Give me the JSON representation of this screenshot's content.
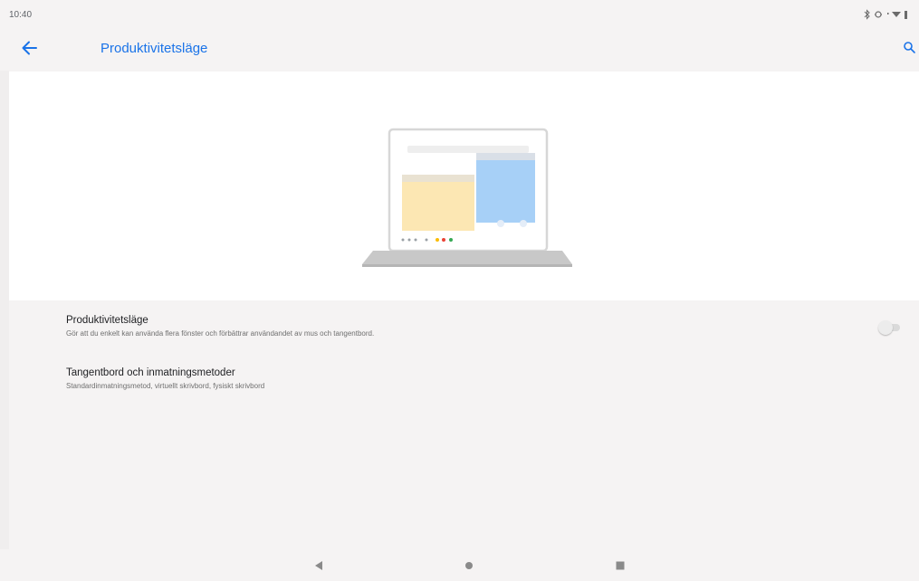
{
  "status_bar": {
    "time": "10:40",
    "icons": [
      "bluetooth-icon",
      "sync-icon",
      "signal-icon",
      "wifi-icon",
      "battery-icon"
    ]
  },
  "app_bar": {
    "title": "Produktivitetsläge",
    "back_icon": "arrow-left-icon",
    "search_icon": "search-icon",
    "accent_color": "#1a73e8"
  },
  "settings": {
    "items": [
      {
        "title": "Produktivitetsläge",
        "subtitle": "Gör att du enkelt kan använda flera fönster och förbättrar användandet av mus och tangentbord.",
        "toggle_on": false
      },
      {
        "title": "Tangentbord och inmatningsmetoder",
        "subtitle": "Standardinmatningsmetod, virtuellt skrivbord, fysiskt skrivbord"
      }
    ]
  },
  "nav_bar": {
    "buttons": [
      "back-triangle-icon",
      "home-circle-icon",
      "recents-square-icon"
    ]
  }
}
